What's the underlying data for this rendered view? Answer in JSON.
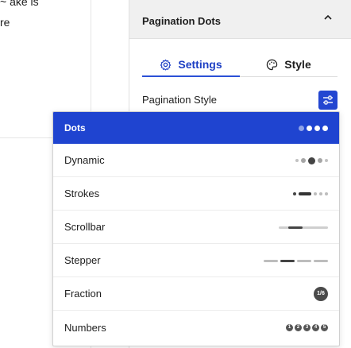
{
  "left": {
    "text_line_1": "~ ake is",
    "text_line_2": "re"
  },
  "panel": {
    "title": "Pagination Dots",
    "tabs": [
      {
        "label": "Settings",
        "active": true
      },
      {
        "label": "Style",
        "active": false
      }
    ],
    "field_label": "Pagination Style"
  },
  "dropdown": {
    "selected": "Dots",
    "options": [
      {
        "label": "Dots",
        "preview": "dots"
      },
      {
        "label": "Dynamic",
        "preview": "dynamic"
      },
      {
        "label": "Strokes",
        "preview": "strokes"
      },
      {
        "label": "Scrollbar",
        "preview": "scrollbar"
      },
      {
        "label": "Stepper",
        "preview": "stepper"
      },
      {
        "label": "Fraction",
        "preview": "fraction"
      },
      {
        "label": "Numbers",
        "preview": "numbers"
      }
    ],
    "fraction_text": "1/6",
    "numbers_text": [
      "1",
      "2",
      "3",
      "4",
      "5"
    ]
  },
  "colors": {
    "accent": "#1f44d0",
    "tab_active": "#1d3fc4",
    "header_bg": "#f0f0f0"
  },
  "icons": {
    "settings_tab": "gear-icon",
    "style_tab": "palette-icon",
    "header_toggle": "chevron-up-icon",
    "field_button": "sliders-icon"
  }
}
